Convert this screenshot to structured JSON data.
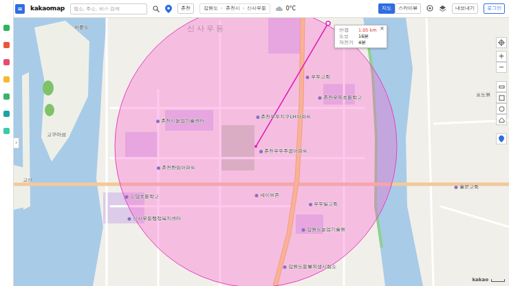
{
  "app": {
    "menu_icon": "≡",
    "logo": "kakaomap"
  },
  "sidebar": {
    "items": [
      {
        "color": "#2fb35c"
      },
      {
        "color": "#e9573f"
      },
      {
        "color": "#e74c6b"
      },
      {
        "color": "#f5b82e"
      },
      {
        "color": "#3bb36a"
      },
      {
        "color": "#1aa3a3"
      },
      {
        "color": "#3ec9a7"
      }
    ],
    "handle": "›"
  },
  "search": {
    "placeholder": "장소, 주소, 버스 검색"
  },
  "region_button": "춘천",
  "breadcrumb": {
    "items": [
      "강원도",
      "춘천시",
      "신사우동"
    ],
    "separator": "›"
  },
  "weather": "0°C",
  "map_types": [
    {
      "label": "지도",
      "selected": true
    },
    {
      "label": "스카이뷰",
      "selected": false
    }
  ],
  "export": "내보내기",
  "login": "로그인",
  "measure": {
    "rows": [
      {
        "label": "반경",
        "value": "1.05 km"
      },
      {
        "label": "도보",
        "value": "16분"
      },
      {
        "label": "자전거",
        "value": "4분"
      }
    ],
    "close": "×"
  },
  "map_labels": [
    {
      "text": "신사우동",
      "kind": "area"
    },
    {
      "text": "하중도",
      "kind": "place"
    },
    {
      "text": "고구마섬",
      "kind": "place"
    },
    {
      "text": "고산",
      "kind": "place"
    },
    {
      "text": "우두교회",
      "kind": "poi"
    },
    {
      "text": "춘천우두초등학교",
      "kind": "poi"
    },
    {
      "text": "춘천우두지구LH아파트",
      "kind": "poi"
    },
    {
      "text": "춘천우두주공아파트",
      "kind": "poi"
    },
    {
      "text": "춘천시농업기술센터",
      "kind": "poi"
    },
    {
      "text": "춘천한림아파트",
      "kind": "poi"
    },
    {
      "text": "소양초등학교",
      "kind": "poi"
    },
    {
      "text": "신사우동행정복지센터",
      "kind": "poi"
    },
    {
      "text": "세이브존",
      "kind": "poi"
    },
    {
      "text": "우두일교회",
      "kind": "poi"
    },
    {
      "text": "강원도농업기술원",
      "kind": "poi"
    },
    {
      "text": "강원도동물위생시험소",
      "kind": "poi"
    },
    {
      "text": "포도원",
      "kind": "place"
    },
    {
      "text": "율문교회",
      "kind": "poi"
    }
  ],
  "zoom": {
    "in": "+",
    "out": "−"
  },
  "brand": "kakao"
}
